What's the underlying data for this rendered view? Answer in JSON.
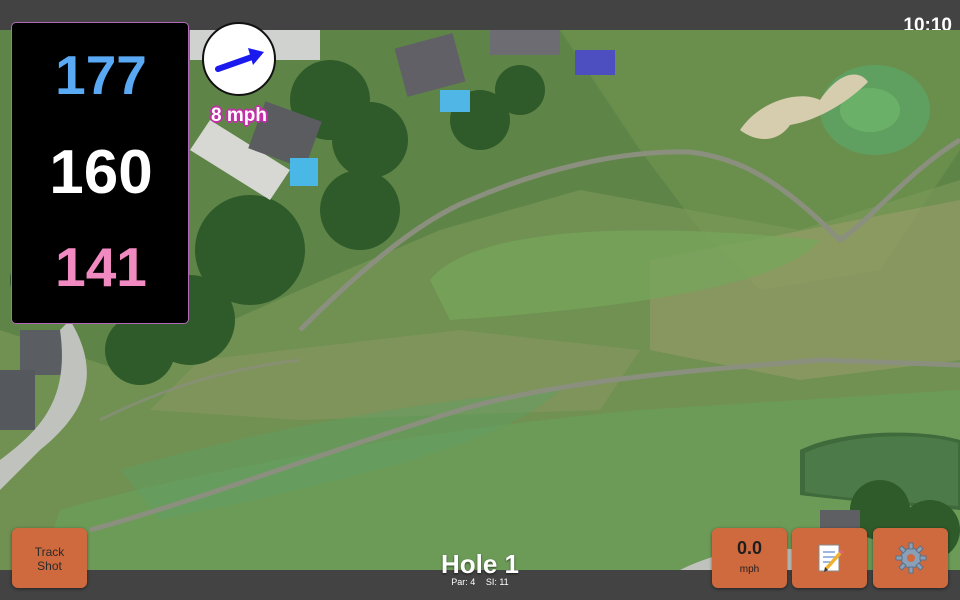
{
  "status": {
    "time": "10:10"
  },
  "distances": {
    "back": "177",
    "middle": "160",
    "front": "141"
  },
  "wind": {
    "speed": "8 mph",
    "arrow_icon": "wind-arrow-icon"
  },
  "hole": {
    "title": "Hole 1",
    "par": "Par: 4",
    "stroke_index": "SI: 11"
  },
  "buttons": {
    "track_shot": {
      "line1": "Track",
      "line2": "Shot"
    },
    "speed": {
      "value": "0.0",
      "unit": "mph"
    },
    "notes": {
      "icon": "notepad-icon"
    },
    "settings": {
      "icon": "gear-icon"
    }
  },
  "colors": {
    "back_distance": "#5aa9f5",
    "middle_distance": "#ffffff",
    "front_distance": "#f08ac0",
    "button": "#cf6a3e",
    "wind_label_outline": "#c42ea8",
    "wind_arrow": "#1a1aee"
  }
}
